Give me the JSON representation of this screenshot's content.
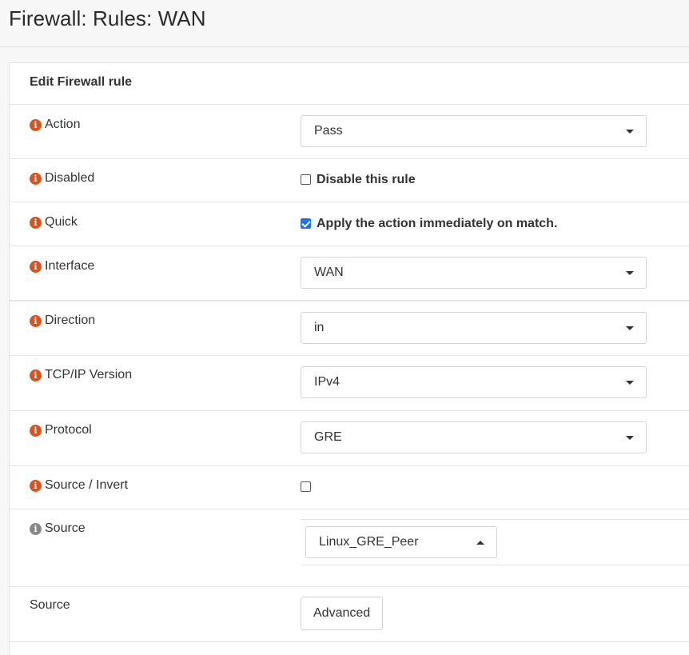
{
  "page": {
    "title": "Firewall: Rules: WAN"
  },
  "panel": {
    "heading": "Edit Firewall rule"
  },
  "fields": {
    "action": {
      "label": "Action",
      "value": "Pass"
    },
    "disabled": {
      "label": "Disabled",
      "checkbox_label": "Disable this rule",
      "checked": false
    },
    "quick": {
      "label": "Quick",
      "checkbox_label": "Apply the action immediately on match.",
      "checked": true
    },
    "interface": {
      "label": "Interface",
      "value": "WAN"
    },
    "direction": {
      "label": "Direction",
      "value": "in"
    },
    "tcpip_version": {
      "label": "TCP/IP Version",
      "value": "IPv4"
    },
    "protocol": {
      "label": "Protocol",
      "value": "GRE"
    },
    "source_invert": {
      "label": "Source / Invert",
      "checked": false
    },
    "source": {
      "label": "Source",
      "value": "Linux_GRE_Peer"
    },
    "source_advanced": {
      "label": "Source",
      "button_label": "Advanced"
    }
  },
  "icons": {
    "info": "info-icon",
    "info_glyph": "i"
  },
  "colors": {
    "info_icon": "#d9531e",
    "info_icon_muted": "#888888",
    "checkbox_checked": "#1a73e8"
  }
}
